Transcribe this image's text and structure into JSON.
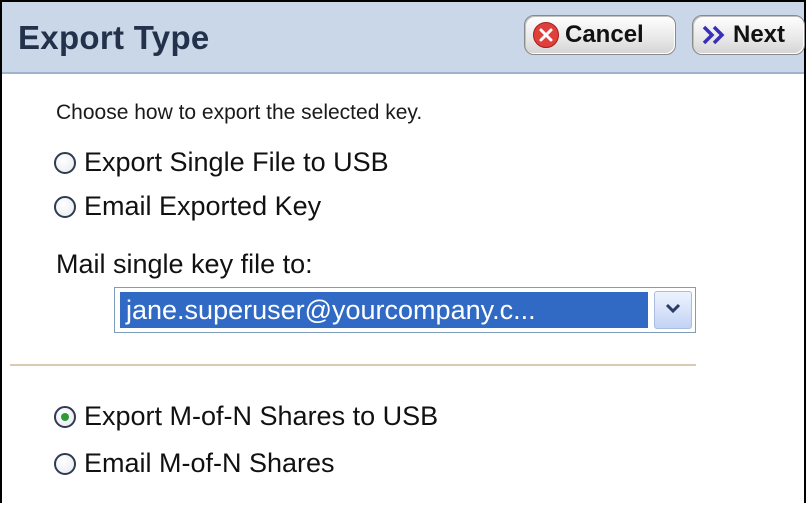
{
  "dialog": {
    "title": "Export Type",
    "cancel_label": "Cancel",
    "next_label": "Next"
  },
  "instruction": "Choose how to export the selected key.",
  "options_top": [
    {
      "label": "Export Single File to USB",
      "selected": false
    },
    {
      "label": "Email Exported Key",
      "selected": false
    }
  ],
  "mail": {
    "label": "Mail single key file to:",
    "selected_value": "jane.superuser@yourcompany.c..."
  },
  "options_bottom": [
    {
      "label": "Export M-of-N Shares to USB",
      "selected": true
    },
    {
      "label": "Email M-of-N Shares",
      "selected": false
    }
  ],
  "colors": {
    "header_bg": "#c9d7e8",
    "title_text": "#23324a",
    "cancel_icon": "#e0403b",
    "next_icon": "#3a2fb8",
    "selection": "#316ac5",
    "radio_checked": "#2e9a3a"
  },
  "icons": {
    "cancel": "cancel-x-circle-icon",
    "next": "double-chevron-right-icon",
    "dropdown": "chevron-down-icon"
  }
}
